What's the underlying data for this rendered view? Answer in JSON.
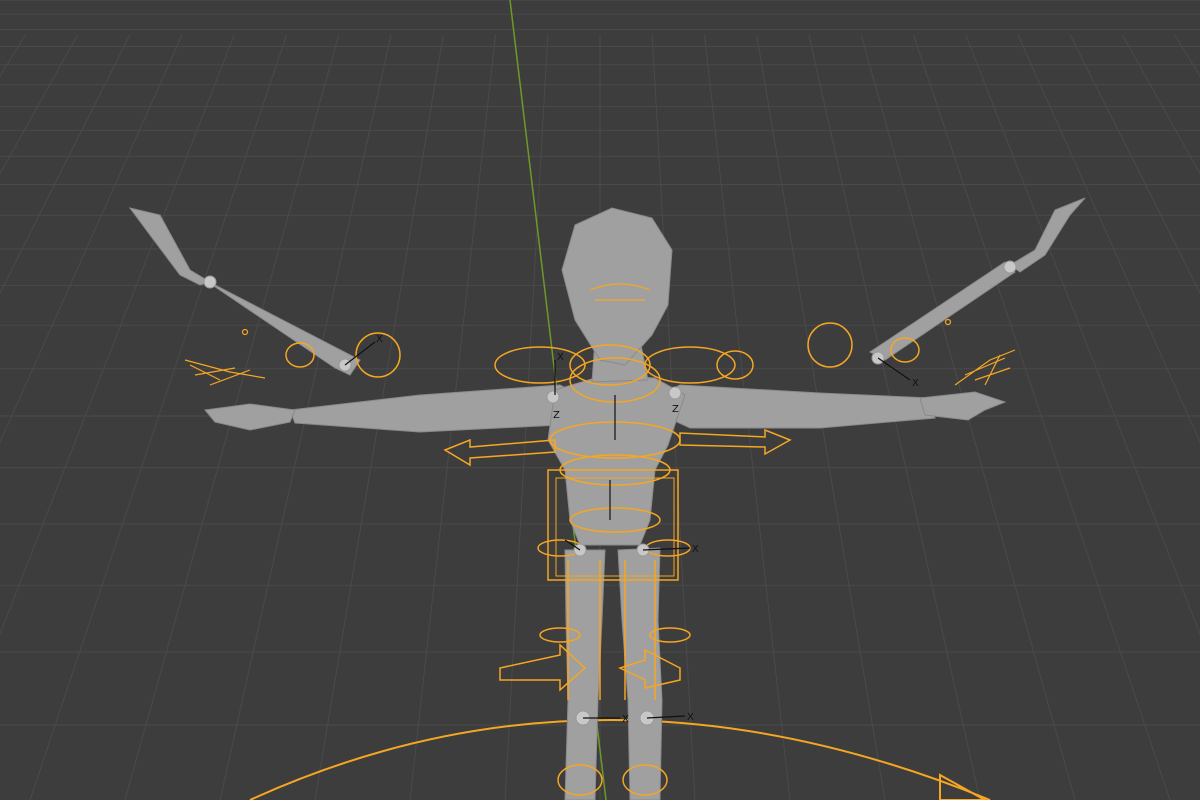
{
  "viewport": {
    "name": "3D Viewport",
    "background_color": "#3d3d3d",
    "grid_color": "#4a4a4a",
    "y_axis_color": "#6c9a2a"
  },
  "scene": {
    "mesh": {
      "name": "character-mesh",
      "color": "#a0a0a0",
      "edge_color": "#8a8a8a"
    },
    "armature": {
      "name": "armature-rig",
      "selected_color": "#f5a623",
      "bone_axis_color": "#111111"
    },
    "axis_labels": {
      "x": "X",
      "z": "Z"
    }
  }
}
